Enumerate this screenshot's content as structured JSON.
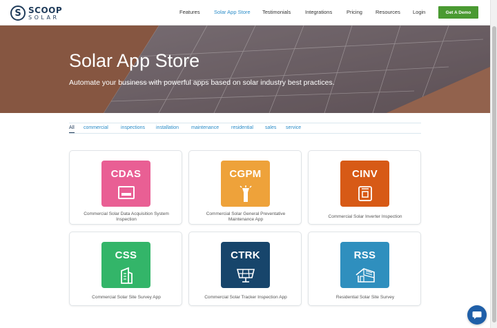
{
  "brand": {
    "top": "SCOOP",
    "bottom": "SOLAR",
    "mark": "S"
  },
  "nav": {
    "items": [
      "Features",
      "Solar App Store",
      "Testimonials",
      "Integrations",
      "Pricing",
      "Resources",
      "Login"
    ],
    "active_index": 1,
    "cta": "Get A Demo"
  },
  "hero": {
    "title": "Solar App Store",
    "subtitle": "Automate your business with powerful apps based on solar industry best practices."
  },
  "filters": {
    "items": [
      "All",
      "commercial",
      "inspections",
      "installation",
      "maintenance",
      "residential",
      "sales",
      "service"
    ],
    "active_index": 0
  },
  "apps": [
    {
      "code": "CDAS",
      "desc": "Commercial Solar Data Acquisition System Inspection",
      "color": "#e95f94",
      "icon": "monitor-icon"
    },
    {
      "code": "CGPM",
      "desc": "Commercial Solar General Preventative Maintenance App",
      "color": "#eea23a",
      "icon": "flashlight-icon"
    },
    {
      "code": "CINV",
      "desc": "Commercial Solar Inverter Inspection",
      "color": "#d75a16",
      "icon": "inverter-icon"
    },
    {
      "code": "CSS",
      "desc": "Commercial Solar Site Survey App",
      "color": "#33b569",
      "icon": "building-icon"
    },
    {
      "code": "CTRK",
      "desc": "Commercial Solar Tracker Inspection App",
      "color": "#17456b",
      "icon": "solar-panel-icon"
    },
    {
      "code": "RSS",
      "desc": "Residential Solar Site Survey",
      "color": "#2f8fbe",
      "icon": "house-icon"
    }
  ],
  "colors": {
    "accent": "#2a8cc8",
    "cta": "#4a9a32",
    "brand": "#1f3b5a"
  },
  "chat": {
    "icon": "chat-bubble-icon"
  }
}
